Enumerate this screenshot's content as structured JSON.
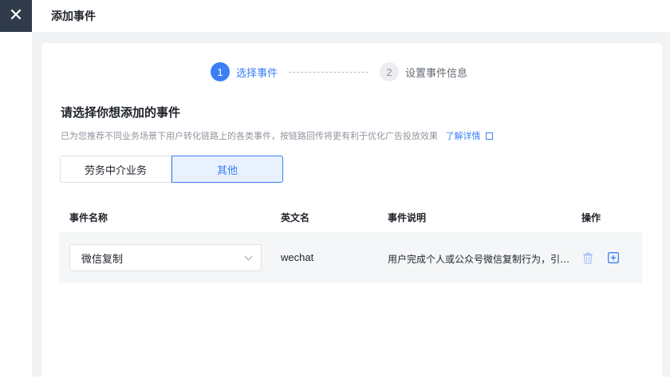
{
  "header": {
    "title": "添加事件",
    "close_icon": "close-icon"
  },
  "steps": [
    {
      "number": "1",
      "label": "选择事件",
      "active": true
    },
    {
      "number": "2",
      "label": "设置事件信息",
      "active": false
    }
  ],
  "content": {
    "title": "请选择你想添加的事件",
    "description": "已为您推荐不同业务场景下用户转化链路上的各类事件，按链路回传将更有利于优化广告投放效果",
    "link_text": "了解详情"
  },
  "tabs": [
    {
      "label": "劳务中介业务",
      "selected": false
    },
    {
      "label": "其他",
      "selected": true
    }
  ],
  "table": {
    "headers": [
      "事件名称",
      "英文名",
      "事件说明",
      "操作"
    ],
    "rows": [
      {
        "event_name": "微信复制",
        "english_name": "wechat",
        "description": "用户完成个人或公众号微信复制行为，引导用户添加微信"
      }
    ]
  },
  "colors": {
    "accent": "#3b7ff5",
    "dark_header": "#2f3a4a",
    "row_bg": "#f5f6f7"
  }
}
